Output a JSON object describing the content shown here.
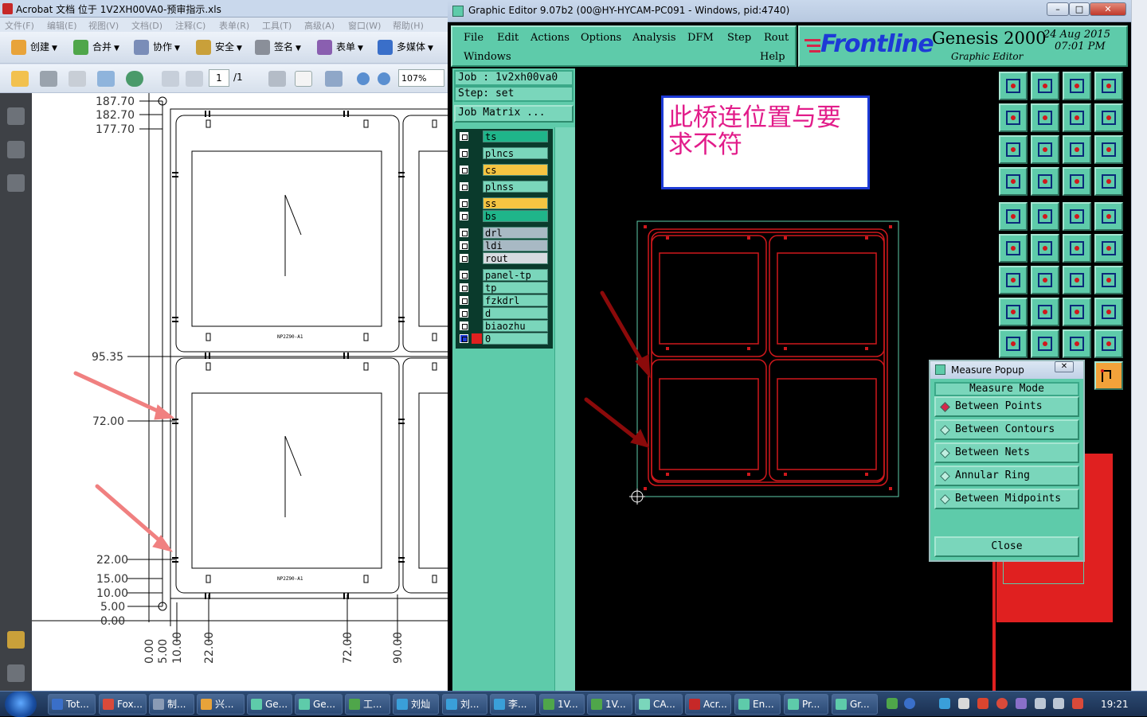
{
  "acrobat": {
    "title": "Acrobat 文档 位于 1V2XH00VA0-预审指示.xls",
    "menu": [
      "文件(F)",
      "编辑(E)",
      "视图(V)",
      "文档(D)",
      "注释(C)",
      "表单(R)",
      "工具(T)",
      "高级(A)",
      "窗口(W)",
      "帮助(H)"
    ],
    "toolbar1": [
      {
        "label": "创建",
        "icon": "create-icon",
        "color": "#e8a33a"
      },
      {
        "label": "合并",
        "icon": "merge-icon",
        "color": "#4fa64a"
      },
      {
        "label": "协作",
        "icon": "collaborate-icon",
        "color": "#7a8db8"
      },
      {
        "label": "安全",
        "icon": "lock-icon",
        "color": "#c9a03a"
      },
      {
        "label": "签名",
        "icon": "pen-icon",
        "color": "#8a8f99"
      },
      {
        "label": "表单",
        "icon": "form-icon",
        "color": "#8a5fb0"
      },
      {
        "label": "多媒体",
        "icon": "multimedia-icon",
        "color": "#3a6fc9"
      }
    ],
    "page_current": "1",
    "page_total": "/1",
    "zoom": "107%",
    "drawing": {
      "y_dims": [
        "187.70",
        "182.70",
        "177.70",
        "95.35",
        "72.00",
        "22.00",
        "15.00",
        "10.00",
        "5.00",
        "0.00"
      ],
      "x_dims": [
        "0.00",
        "5.00",
        "10.00",
        "22.00",
        "72.00",
        "90.00"
      ],
      "barcode": "NP2Z90-A1"
    }
  },
  "genesis": {
    "title": "Graphic Editor 9.07b2 (00@HY-HYCAM-PC091 - Windows, pid:4740)",
    "menu": [
      "File",
      "Edit",
      "Actions",
      "Options",
      "Analysis",
      "DFM",
      "Step",
      "Rout",
      "Windows",
      "Help"
    ],
    "brand": "Frontline",
    "product": "Genesis 2000",
    "subtitle": "Graphic Editor",
    "date": "24 Aug 2015",
    "time": "07:01 PM",
    "job": "Job : 1v2xh00va0",
    "step": "Step: set",
    "job_matrix": "Job Matrix ...",
    "layers": [
      {
        "name": "ts",
        "color": "#1fb58a"
      },
      {
        "name": "plncs",
        "color": "#7ad6bb"
      },
      {
        "name": "cs",
        "color": "#f5c542"
      },
      {
        "name": "plnss",
        "color": "#7ad6bb"
      },
      {
        "name": "ss",
        "color": "#f5c542"
      },
      {
        "name": "bs",
        "color": "#1fb58a"
      },
      {
        "name": "drl",
        "color": "#a8b9c4"
      },
      {
        "name": "ldi",
        "color": "#a8b9c4"
      },
      {
        "name": "rout",
        "color": "#d6dbe0"
      },
      {
        "name": "panel-tp",
        "color": "#7ad6bb"
      },
      {
        "name": "tp",
        "color": "#7ad6bb"
      },
      {
        "name": "fzkdrl",
        "color": "#7ad6bb"
      },
      {
        "name": "d",
        "color": "#7ad6bb"
      },
      {
        "name": "biaozhu",
        "color": "#7ad6bb"
      },
      {
        "name": "0",
        "color": "#7ad6bb"
      }
    ],
    "note_text": "此桥连位置与要求不符",
    "measure": {
      "title": "Measure Popup",
      "mode_header": "Measure Mode",
      "options": [
        "Between Points",
        "Between Contours",
        "Between Nets",
        "Annular Ring",
        "Between Midpoints"
      ],
      "selected": "Between Points",
      "close_label": "Close"
    }
  },
  "taskbar": {
    "items": [
      {
        "label": "Tot...",
        "color": "#3a6fc9"
      },
      {
        "label": "Fox...",
        "color": "#d94a3a"
      },
      {
        "label": "制...",
        "color": "#8a9bb5"
      },
      {
        "label": "兴...",
        "color": "#e8a33a"
      },
      {
        "label": "Ge...",
        "color": "#5ecbaa"
      },
      {
        "label": "Ge...",
        "color": "#5ecbaa"
      },
      {
        "label": "工...",
        "color": "#4fa64a"
      },
      {
        "label": "刘灿",
        "color": "#3a9fd9"
      },
      {
        "label": "刘...",
        "color": "#3a9fd9"
      },
      {
        "label": "李...",
        "color": "#3a9fd9"
      },
      {
        "label": "1V...",
        "color": "#4fa64a"
      },
      {
        "label": "1V...",
        "color": "#4fa64a"
      },
      {
        "label": "CA...",
        "color": "#7ad6bb"
      },
      {
        "label": "Acr...",
        "color": "#c62828"
      },
      {
        "label": "En...",
        "color": "#5ecbaa"
      },
      {
        "label": "Pr...",
        "color": "#5ecbaa"
      },
      {
        "label": "Gr...",
        "color": "#5ecbaa"
      }
    ],
    "clock": "19:21"
  }
}
